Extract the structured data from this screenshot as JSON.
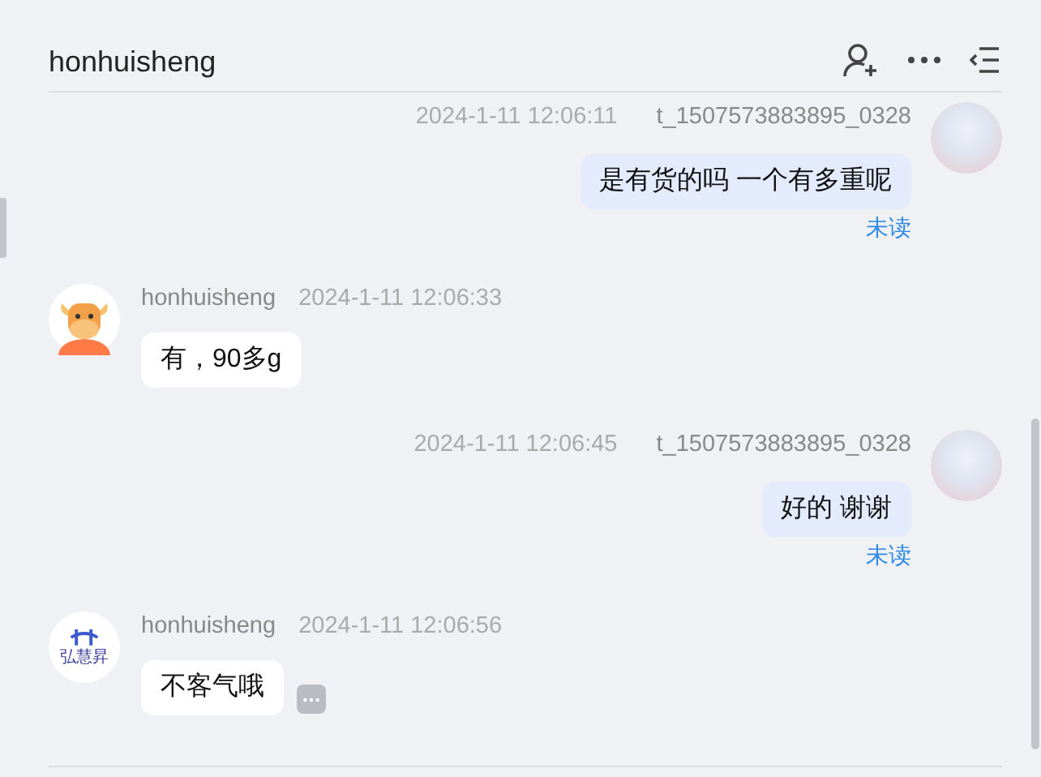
{
  "header": {
    "title": "honhuisheng"
  },
  "messages": [
    {
      "kind": "outgoing",
      "avatar": {
        "kind": "photo"
      },
      "time": "2024-1-11 12:06:11",
      "sender": "t_1507573883895_0328",
      "text": "是有货的吗 一个有多重呢",
      "status": "未读"
    },
    {
      "kind": "incoming",
      "avatar": {
        "kind": "bull"
      },
      "sender": "honhuisheng",
      "time": "2024-1-11 12:06:33",
      "text": "有，90多g"
    },
    {
      "kind": "outgoing",
      "avatar": {
        "kind": "photo"
      },
      "time": "2024-1-11 12:06:45",
      "sender": "t_1507573883895_0328",
      "text": "好的 谢谢",
      "status": "未读"
    },
    {
      "kind": "incoming",
      "avatar": {
        "kind": "logo",
        "text": "弘慧昇"
      },
      "sender": "honhuisheng",
      "time": "2024-1-11 12:06:56",
      "text": "不客气哦",
      "show_actions": true
    }
  ]
}
